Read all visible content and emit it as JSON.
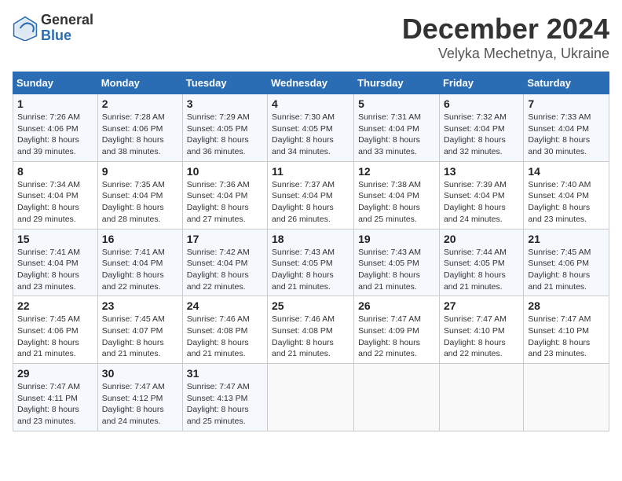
{
  "logo": {
    "general": "General",
    "blue": "Blue"
  },
  "title": "December 2024",
  "location": "Velyka Mechetnya, Ukraine",
  "weekdays": [
    "Sunday",
    "Monday",
    "Tuesday",
    "Wednesday",
    "Thursday",
    "Friday",
    "Saturday"
  ],
  "weeks": [
    [
      {
        "day": "1",
        "sunrise": "Sunrise: 7:26 AM",
        "sunset": "Sunset: 4:06 PM",
        "daylight": "Daylight: 8 hours and 39 minutes."
      },
      {
        "day": "2",
        "sunrise": "Sunrise: 7:28 AM",
        "sunset": "Sunset: 4:06 PM",
        "daylight": "Daylight: 8 hours and 38 minutes."
      },
      {
        "day": "3",
        "sunrise": "Sunrise: 7:29 AM",
        "sunset": "Sunset: 4:05 PM",
        "daylight": "Daylight: 8 hours and 36 minutes."
      },
      {
        "day": "4",
        "sunrise": "Sunrise: 7:30 AM",
        "sunset": "Sunset: 4:05 PM",
        "daylight": "Daylight: 8 hours and 34 minutes."
      },
      {
        "day": "5",
        "sunrise": "Sunrise: 7:31 AM",
        "sunset": "Sunset: 4:04 PM",
        "daylight": "Daylight: 8 hours and 33 minutes."
      },
      {
        "day": "6",
        "sunrise": "Sunrise: 7:32 AM",
        "sunset": "Sunset: 4:04 PM",
        "daylight": "Daylight: 8 hours and 32 minutes."
      },
      {
        "day": "7",
        "sunrise": "Sunrise: 7:33 AM",
        "sunset": "Sunset: 4:04 PM",
        "daylight": "Daylight: 8 hours and 30 minutes."
      }
    ],
    [
      {
        "day": "8",
        "sunrise": "Sunrise: 7:34 AM",
        "sunset": "Sunset: 4:04 PM",
        "daylight": "Daylight: 8 hours and 29 minutes."
      },
      {
        "day": "9",
        "sunrise": "Sunrise: 7:35 AM",
        "sunset": "Sunset: 4:04 PM",
        "daylight": "Daylight: 8 hours and 28 minutes."
      },
      {
        "day": "10",
        "sunrise": "Sunrise: 7:36 AM",
        "sunset": "Sunset: 4:04 PM",
        "daylight": "Daylight: 8 hours and 27 minutes."
      },
      {
        "day": "11",
        "sunrise": "Sunrise: 7:37 AM",
        "sunset": "Sunset: 4:04 PM",
        "daylight": "Daylight: 8 hours and 26 minutes."
      },
      {
        "day": "12",
        "sunrise": "Sunrise: 7:38 AM",
        "sunset": "Sunset: 4:04 PM",
        "daylight": "Daylight: 8 hours and 25 minutes."
      },
      {
        "day": "13",
        "sunrise": "Sunrise: 7:39 AM",
        "sunset": "Sunset: 4:04 PM",
        "daylight": "Daylight: 8 hours and 24 minutes."
      },
      {
        "day": "14",
        "sunrise": "Sunrise: 7:40 AM",
        "sunset": "Sunset: 4:04 PM",
        "daylight": "Daylight: 8 hours and 23 minutes."
      }
    ],
    [
      {
        "day": "15",
        "sunrise": "Sunrise: 7:41 AM",
        "sunset": "Sunset: 4:04 PM",
        "daylight": "Daylight: 8 hours and 23 minutes."
      },
      {
        "day": "16",
        "sunrise": "Sunrise: 7:41 AM",
        "sunset": "Sunset: 4:04 PM",
        "daylight": "Daylight: 8 hours and 22 minutes."
      },
      {
        "day": "17",
        "sunrise": "Sunrise: 7:42 AM",
        "sunset": "Sunset: 4:04 PM",
        "daylight": "Daylight: 8 hours and 22 minutes."
      },
      {
        "day": "18",
        "sunrise": "Sunrise: 7:43 AM",
        "sunset": "Sunset: 4:05 PM",
        "daylight": "Daylight: 8 hours and 21 minutes."
      },
      {
        "day": "19",
        "sunrise": "Sunrise: 7:43 AM",
        "sunset": "Sunset: 4:05 PM",
        "daylight": "Daylight: 8 hours and 21 minutes."
      },
      {
        "day": "20",
        "sunrise": "Sunrise: 7:44 AM",
        "sunset": "Sunset: 4:05 PM",
        "daylight": "Daylight: 8 hours and 21 minutes."
      },
      {
        "day": "21",
        "sunrise": "Sunrise: 7:45 AM",
        "sunset": "Sunset: 4:06 PM",
        "daylight": "Daylight: 8 hours and 21 minutes."
      }
    ],
    [
      {
        "day": "22",
        "sunrise": "Sunrise: 7:45 AM",
        "sunset": "Sunset: 4:06 PM",
        "daylight": "Daylight: 8 hours and 21 minutes."
      },
      {
        "day": "23",
        "sunrise": "Sunrise: 7:45 AM",
        "sunset": "Sunset: 4:07 PM",
        "daylight": "Daylight: 8 hours and 21 minutes."
      },
      {
        "day": "24",
        "sunrise": "Sunrise: 7:46 AM",
        "sunset": "Sunset: 4:08 PM",
        "daylight": "Daylight: 8 hours and 21 minutes."
      },
      {
        "day": "25",
        "sunrise": "Sunrise: 7:46 AM",
        "sunset": "Sunset: 4:08 PM",
        "daylight": "Daylight: 8 hours and 21 minutes."
      },
      {
        "day": "26",
        "sunrise": "Sunrise: 7:47 AM",
        "sunset": "Sunset: 4:09 PM",
        "daylight": "Daylight: 8 hours and 22 minutes."
      },
      {
        "day": "27",
        "sunrise": "Sunrise: 7:47 AM",
        "sunset": "Sunset: 4:10 PM",
        "daylight": "Daylight: 8 hours and 22 minutes."
      },
      {
        "day": "28",
        "sunrise": "Sunrise: 7:47 AM",
        "sunset": "Sunset: 4:10 PM",
        "daylight": "Daylight: 8 hours and 23 minutes."
      }
    ],
    [
      {
        "day": "29",
        "sunrise": "Sunrise: 7:47 AM",
        "sunset": "Sunset: 4:11 PM",
        "daylight": "Daylight: 8 hours and 23 minutes."
      },
      {
        "day": "30",
        "sunrise": "Sunrise: 7:47 AM",
        "sunset": "Sunset: 4:12 PM",
        "daylight": "Daylight: 8 hours and 24 minutes."
      },
      {
        "day": "31",
        "sunrise": "Sunrise: 7:47 AM",
        "sunset": "Sunset: 4:13 PM",
        "daylight": "Daylight: 8 hours and 25 minutes."
      },
      null,
      null,
      null,
      null
    ]
  ]
}
